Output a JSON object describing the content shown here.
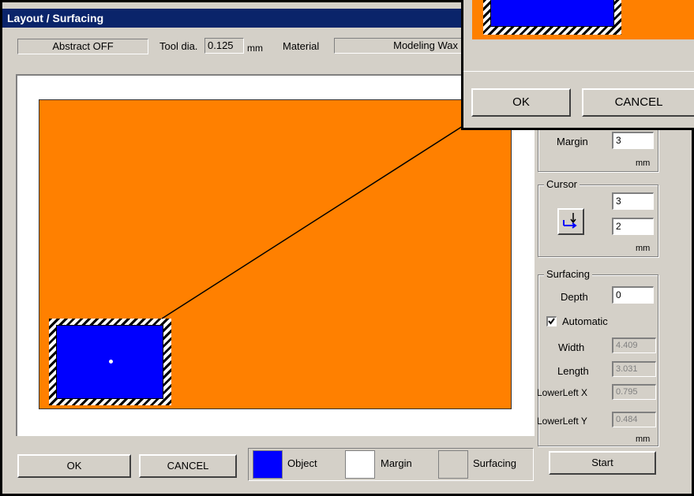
{
  "window": {
    "title": "Layout / Surfacing"
  },
  "toolbar": {
    "abstract_label": "Abstract OFF",
    "tool_dia_label": "Tool dia.",
    "tool_dia_value": "0.125",
    "tool_dia_unit": "mm",
    "material_label": "Material",
    "material_value": "Modeling Wax"
  },
  "layout_panel": {
    "work_color": "#ff8000",
    "object_color": "#0000ff"
  },
  "right_panel": {
    "margin_label": "Margin",
    "margin_value": "3",
    "margin_unit": "mm",
    "cursor_group": "Cursor",
    "cursor_x": "3",
    "cursor_y": "2",
    "cursor_unit": "mm",
    "surfacing_group": "Surfacing",
    "depth_label": "Depth",
    "depth_value": "0",
    "automatic_label": "Automatic",
    "automatic_checked": true,
    "width_label": "Width",
    "width_value": "4.409",
    "length_label": "Length",
    "length_value": "3.031",
    "lowerleft_x_label": "LowerLeft X",
    "lowerleft_x_value": "0.795",
    "lowerleft_y_label": "LowerLeft Y",
    "lowerleft_y_value": "0.484",
    "surfacing_unit": "mm",
    "start_label": "Start"
  },
  "bottom_bar": {
    "ok_label": "OK",
    "cancel_label": "CANCEL",
    "legend": [
      {
        "label": "Object",
        "color": "#0000ff"
      },
      {
        "label": "Margin",
        "color": "#ffffff"
      },
      {
        "label": "Surfacing",
        "color": "#d4d0c8"
      }
    ]
  },
  "zoom_inset": {
    "ok_label": "OK",
    "cancel_label": "CANCEL"
  }
}
